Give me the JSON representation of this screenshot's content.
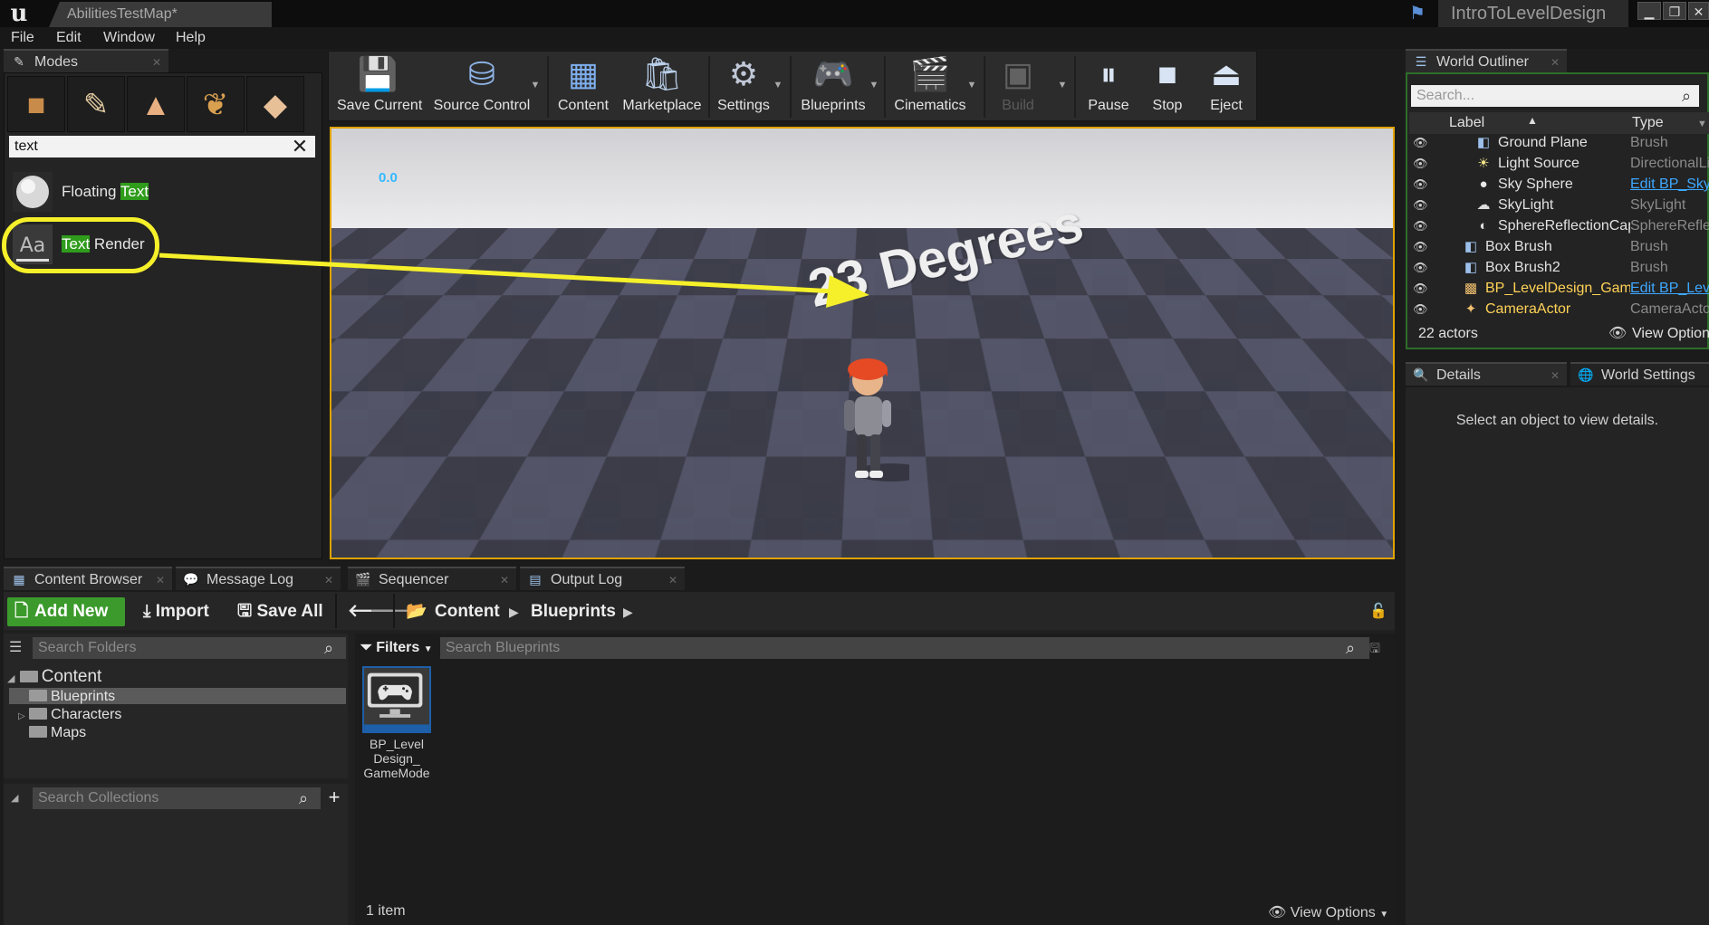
{
  "title_bar": {
    "logo": "u",
    "document_tab": "AbilitiesTestMap*",
    "project_name": "IntroToLevelDesign",
    "window_buttons": [
      "▁",
      "❐",
      "✕"
    ]
  },
  "menu": [
    "File",
    "Edit",
    "Window",
    "Help"
  ],
  "modes_panel": {
    "tab_label": "Modes",
    "search_value": "text",
    "results": [
      {
        "prefix": "Floating ",
        "match": "Text",
        "suffix": ""
      },
      {
        "prefix": "",
        "match": "Text",
        "suffix": " Render"
      }
    ]
  },
  "toolbar": {
    "buttons": [
      {
        "label": "Save Current",
        "icon": "save-icon"
      },
      {
        "label": "Source Control",
        "icon": "source-control-icon"
      },
      {
        "label": "Content",
        "icon": "content-icon"
      },
      {
        "label": "Marketplace",
        "icon": "marketplace-icon"
      },
      {
        "label": "Settings",
        "icon": "settings-icon"
      },
      {
        "label": "Blueprints",
        "icon": "blueprints-icon"
      },
      {
        "label": "Cinematics",
        "icon": "cinematics-icon"
      },
      {
        "label": "Build",
        "icon": "build-icon"
      },
      {
        "label": "Pause",
        "icon": "pause-icon"
      },
      {
        "label": "Stop",
        "icon": "stop-icon"
      },
      {
        "label": "Eject",
        "icon": "eject-icon"
      }
    ]
  },
  "viewport": {
    "fps": "0.0",
    "world_text": "23 Degrees"
  },
  "world_outliner": {
    "tab_label": "World Outliner",
    "search_placeholder": "Search...",
    "columns": {
      "label": "Label",
      "type": "Type"
    },
    "rows": [
      {
        "label": "Ground Plane",
        "type": "Brush",
        "indent": 2,
        "type_link": false
      },
      {
        "label": "Light Source",
        "type": "DirectionalLi",
        "indent": 2,
        "type_link": false
      },
      {
        "label": "Sky Sphere",
        "type": "Edit BP_Sky",
        "indent": 2,
        "type_link": true
      },
      {
        "label": "SkyLight",
        "type": "SkyLight",
        "indent": 2,
        "type_link": false
      },
      {
        "label": "SphereReflectionCap",
        "type": "SphereReflec",
        "indent": 2,
        "type_link": false
      },
      {
        "label": "Box Brush",
        "type": "Brush",
        "indent": 1,
        "type_link": false
      },
      {
        "label": "Box Brush2",
        "type": "Brush",
        "indent": 1,
        "type_link": false
      },
      {
        "label": "BP_LevelDesign_GameI",
        "type": "Edit BP_Lev",
        "indent": 1,
        "type_link": true
      },
      {
        "label": "CameraActor",
        "type": "CameraActo",
        "indent": 1,
        "type_link": false
      }
    ],
    "actor_count": "22 actors",
    "view_options": "View Options"
  },
  "details": {
    "tab_details": "Details",
    "tab_world_settings": "World Settings",
    "empty_message": "Select an object to view details."
  },
  "bottom_tabs": [
    "Content Browser",
    "Message Log",
    "Sequencer",
    "Output Log"
  ],
  "content_browser": {
    "add_new": "Add New",
    "import": "Import",
    "save_all": "Save All",
    "breadcrumb": [
      "Content",
      "Blueprints"
    ],
    "folder_search_placeholder": "Search Folders",
    "tree": {
      "root": "Content",
      "children": [
        "Blueprints",
        "Characters",
        "Maps"
      ]
    },
    "collections_search_placeholder": "Search Collections",
    "filters": "Filters",
    "asset_search_placeholder": "Search Blueprints",
    "asset_name_lines": [
      "BP_Level",
      "Design_",
      "GameMode"
    ],
    "item_count": "1 item",
    "view_options": "View Options"
  },
  "colors": {
    "accent_green": "#3b9a2b",
    "highlight_yellow": "#f5f02a",
    "viewport_border": "#e0a300",
    "link_blue": "#3ea8ff"
  }
}
